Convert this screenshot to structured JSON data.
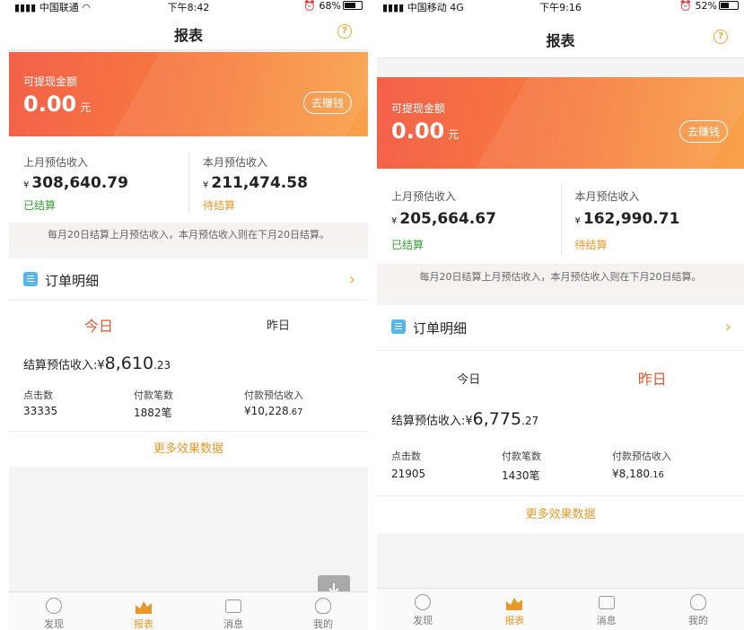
{
  "phones": [
    {
      "status": {
        "carrier": "中国联通",
        "network": "",
        "time": "下午8:42",
        "battery": "68%"
      },
      "title": "报表",
      "help_icon": "question-circle-icon",
      "banner": {
        "label": "可提现金额",
        "amount": "0.00",
        "unit": "元",
        "earn_button": "去赚钱"
      },
      "income": {
        "last_month": {
          "label": "上月预估收入",
          "currency": "¥",
          "value": "308,640.79",
          "status": "已结算"
        },
        "this_month": {
          "label": "本月预估收入",
          "currency": "¥",
          "value": "211,474.58",
          "status": "待结算"
        }
      },
      "notice": "每月20日结算上月预估收入，本月预估收入则在下月20日结算。",
      "orders": {
        "title": "订单明细",
        "tabs": [
          {
            "label": "今日",
            "active": true
          },
          {
            "label": "昨日",
            "active": false
          }
        ],
        "settle_label": "结算预估收入:",
        "settle_currency": "¥",
        "settle_int": "8,610",
        "settle_dec": ".23",
        "stats": [
          {
            "label": "点击数",
            "value": "33335",
            "dec": ""
          },
          {
            "label": "付款笔数",
            "value": "1882笔",
            "dec": ""
          },
          {
            "label": "付款预估收入",
            "value": "¥10,228",
            "dec": ".67"
          }
        ],
        "more": "更多效果数据"
      },
      "tabbar": [
        {
          "label": "发现",
          "icon": "face-icon",
          "active": false
        },
        {
          "label": "报表",
          "icon": "chart-icon",
          "active": true
        },
        {
          "label": "消息",
          "icon": "message-icon",
          "active": false
        },
        {
          "label": "我的",
          "icon": "user-icon",
          "active": false
        }
      ]
    },
    {
      "status": {
        "carrier": "中国移动",
        "network": "4G",
        "time": "下午9:16",
        "battery": "52%"
      },
      "title": "报表",
      "help_icon": "question-circle-icon",
      "banner": {
        "label": "可提现金额",
        "amount": "0.00",
        "unit": "元",
        "earn_button": "去赚钱"
      },
      "income": {
        "last_month": {
          "label": "上月预估收入",
          "currency": "¥",
          "value": "205,664.67",
          "status": "已结算"
        },
        "this_month": {
          "label": "本月预估收入",
          "currency": "¥",
          "value": "162,990.71",
          "status": "待结算"
        }
      },
      "notice": "每月20日结算上月预估收入，本月预估收入则在下月20日结算。",
      "orders": {
        "title": "订单明细",
        "tabs": [
          {
            "label": "今日",
            "active": false
          },
          {
            "label": "昨日",
            "active": true
          }
        ],
        "settle_label": "结算预估收入:",
        "settle_currency": "¥",
        "settle_int": "6,775",
        "settle_dec": ".27",
        "stats": [
          {
            "label": "点击数",
            "value": "21905",
            "dec": ""
          },
          {
            "label": "付款笔数",
            "value": "1430笔",
            "dec": ""
          },
          {
            "label": "付款预估收入",
            "value": "¥8,180",
            "dec": ".16"
          }
        ],
        "more": "更多效果数据"
      },
      "tabbar": [
        {
          "label": "发现",
          "icon": "face-icon",
          "active": false
        },
        {
          "label": "报表",
          "icon": "chart-icon",
          "active": true
        },
        {
          "label": "消息",
          "icon": "message-icon",
          "active": false
        },
        {
          "label": "我的",
          "icon": "user-icon",
          "active": false
        }
      ]
    }
  ],
  "colors": {
    "accent": "#e79a2b",
    "banner_start": "#f4614a",
    "banner_end": "#f8a24a",
    "settled": "#3a9b3a",
    "active_tab": "#e2562f"
  }
}
